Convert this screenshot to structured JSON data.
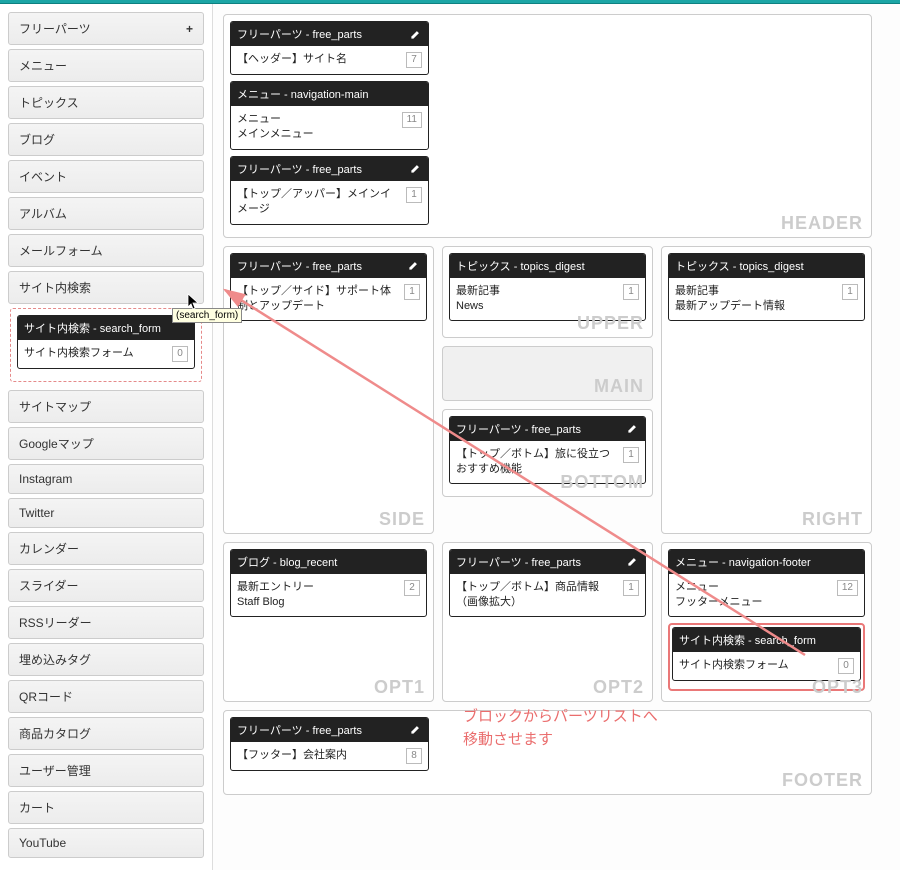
{
  "sidebar": {
    "items": [
      {
        "label": "フリーパーツ",
        "plus": "+"
      },
      {
        "label": "メニュー"
      },
      {
        "label": "トピックス"
      },
      {
        "label": "ブログ"
      },
      {
        "label": "イベント"
      },
      {
        "label": "アルバム"
      },
      {
        "label": "メールフォーム"
      },
      {
        "label": "サイト内検索"
      },
      {
        "label": "サイトマップ"
      },
      {
        "label": "Googleマップ"
      },
      {
        "label": "Instagram"
      },
      {
        "label": "Twitter"
      },
      {
        "label": "カレンダー"
      },
      {
        "label": "スライダー"
      },
      {
        "label": "RSSリーダー"
      },
      {
        "label": "埋め込みタグ"
      },
      {
        "label": "QRコード"
      },
      {
        "label": "商品カタログ"
      },
      {
        "label": "ユーザー管理"
      },
      {
        "label": "カート"
      },
      {
        "label": "YouTube"
      }
    ],
    "dragging": {
      "head": "サイト内検索 - search_form",
      "body": "サイト内検索フォーム",
      "count": "0"
    },
    "tooltip": "(search_form)"
  },
  "zones": {
    "header": {
      "label": "HEADER",
      "blocks": [
        {
          "head": "フリーパーツ - free_parts",
          "body": "【ヘッダー】サイト名",
          "count": "7",
          "edit": true
        },
        {
          "head": "メニュー - navigation-main",
          "body": "メニュー\nメインメニュー",
          "count": "11",
          "edit": false
        },
        {
          "head": "フリーパーツ - free_parts",
          "body": "【トップ／アッパー】メインイメージ",
          "count": "1",
          "edit": true
        }
      ]
    },
    "side": {
      "label": "SIDE",
      "blocks": [
        {
          "head": "フリーパーツ - free_parts",
          "body": "【トップ／サイド】サポート体制とアップデート",
          "count": "1",
          "edit": true
        }
      ]
    },
    "upper": {
      "label": "UPPER",
      "blocks": [
        {
          "head": "トピックス - topics_digest",
          "body": "最新記事\nNews",
          "count": "1",
          "edit": false
        }
      ]
    },
    "mainz": {
      "label": "MAIN"
    },
    "bottom": {
      "label": "BOTTOM",
      "blocks": [
        {
          "head": "フリーパーツ - free_parts",
          "body": "【トップ／ボトム】旅に役立つおすすめ機能",
          "count": "1",
          "edit": true
        }
      ]
    },
    "right": {
      "label": "RIGHT",
      "blocks": [
        {
          "head": "トピックス - topics_digest",
          "body": "最新記事\n最新アップデート情報",
          "count": "1",
          "edit": false
        }
      ]
    },
    "opt1": {
      "label": "OPT1",
      "blocks": [
        {
          "head": "ブログ - blog_recent",
          "body": "最新エントリー\nStaff Blog",
          "count": "2",
          "edit": false
        }
      ]
    },
    "opt2": {
      "label": "OPT2",
      "blocks": [
        {
          "head": "フリーパーツ - free_parts",
          "body": "【トップ／ボトム】商品情報（画像拡大）",
          "count": "1",
          "edit": true
        }
      ]
    },
    "opt3": {
      "label": "OPT3",
      "blocks": [
        {
          "head": "メニュー - navigation-footer",
          "body": "メニュー\nフッターメニュー",
          "count": "12",
          "edit": false
        },
        {
          "head": "サイト内検索 - search_form",
          "body": "サイト内検索フォーム",
          "count": "0",
          "edit": false,
          "highlight": true
        }
      ]
    },
    "footer": {
      "label": "FOOTER",
      "blocks": [
        {
          "head": "フリーパーツ - free_parts",
          "body": "【フッター】会社案内",
          "count": "8",
          "edit": true
        }
      ]
    }
  },
  "annotation": "ブロックからパーツリストへ\n移動させます"
}
